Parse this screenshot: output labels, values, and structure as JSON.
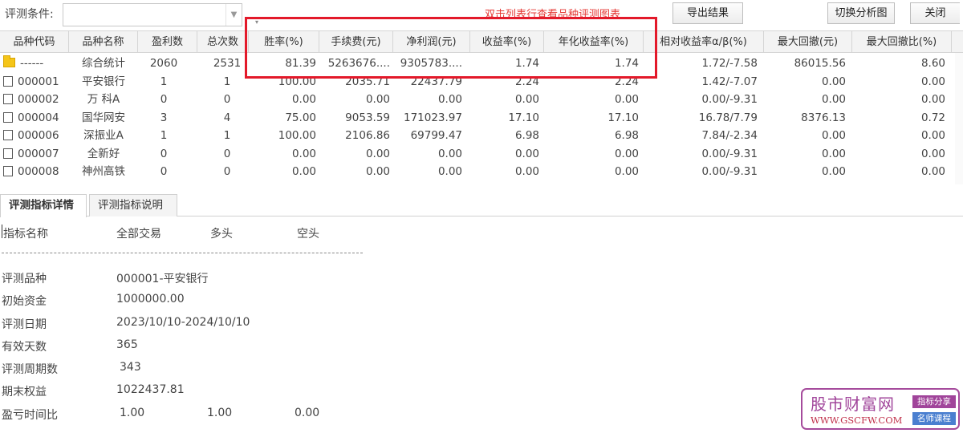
{
  "toolbar": {
    "condition_label": "评测条件:",
    "condition_value": "",
    "hint": "双击列表行查看品种评测图表",
    "export_label": "导出结果",
    "switch_label": "切换分析图",
    "close_label": "关闭"
  },
  "grid": {
    "headers": [
      "品种代码",
      "品种名称",
      "盈利数",
      "总次数",
      "胜率(%)",
      "手续费(元)",
      "净利润(元)",
      "收益率(%)",
      "年化收益率(%)",
      "相对收益率α/β(%)",
      "最大回撤(元)",
      "最大回撤比(%)"
    ],
    "rows": [
      {
        "code": "------",
        "name": "综合统计",
        "wins": "2060",
        "total": "2531",
        "win_rate": "81.39",
        "fee": "5263676....",
        "net": "9305783....",
        "ret": "1.74",
        "annual": "1.74",
        "rel": "1.72/-7.58",
        "dd": "86015.56",
        "dd_ratio": "8.60"
      },
      {
        "code": "000001",
        "name": "平安银行",
        "wins": "1",
        "total": "1",
        "win_rate": "100.00",
        "fee": "2035.71",
        "net": "22437.79",
        "ret": "2.24",
        "annual": "2.24",
        "rel": "1.42/-7.07",
        "dd": "0.00",
        "dd_ratio": "0.00"
      },
      {
        "code": "000002",
        "name": "万 科A",
        "wins": "0",
        "total": "0",
        "win_rate": "0.00",
        "fee": "0.00",
        "net": "0.00",
        "ret": "0.00",
        "annual": "0.00",
        "rel": "0.00/-9.31",
        "dd": "0.00",
        "dd_ratio": "0.00"
      },
      {
        "code": "000004",
        "name": "国华网安",
        "wins": "3",
        "total": "4",
        "win_rate": "75.00",
        "fee": "9053.59",
        "net": "171023.97",
        "ret": "17.10",
        "annual": "17.10",
        "rel": "16.78/7.79",
        "dd": "8376.13",
        "dd_ratio": "0.72"
      },
      {
        "code": "000006",
        "name": "深振业A",
        "wins": "1",
        "total": "1",
        "win_rate": "100.00",
        "fee": "2106.86",
        "net": "69799.47",
        "ret": "6.98",
        "annual": "6.98",
        "rel": "7.84/-2.34",
        "dd": "0.00",
        "dd_ratio": "0.00"
      },
      {
        "code": "000007",
        "name": "全新好",
        "wins": "0",
        "total": "0",
        "win_rate": "0.00",
        "fee": "0.00",
        "net": "0.00",
        "ret": "0.00",
        "annual": "0.00",
        "rel": "0.00/-9.31",
        "dd": "0.00",
        "dd_ratio": "0.00"
      },
      {
        "code": "000008",
        "name": "神州高铁",
        "wins": "0",
        "total": "0",
        "win_rate": "0.00",
        "fee": "0.00",
        "net": "0.00",
        "ret": "0.00",
        "annual": "0.00",
        "rel": "0.00/-9.31",
        "dd": "0.00",
        "dd_ratio": "0.00"
      }
    ]
  },
  "tabs": {
    "detail": "评测指标详情",
    "explain": "评测指标说明"
  },
  "detail": {
    "headers": {
      "metric": "指标名称",
      "all": "全部交易",
      "long": "多头",
      "short": "空头"
    },
    "items": [
      {
        "label": "评测品种",
        "value": "000001-平安银行"
      },
      {
        "label": "初始资金",
        "value": "1000000.00"
      },
      {
        "label": "评测日期",
        "value": "2023/10/10-2024/10/10"
      },
      {
        "label": "有效天数",
        "value": "365"
      },
      {
        "label": "评测周期数",
        "value": "343"
      },
      {
        "label": "期末权益",
        "value": "1022437.81"
      }
    ],
    "ratio_row": {
      "label": "盈亏时间比",
      "all": "1.00",
      "long": "1.00",
      "short": "0.00"
    }
  },
  "watermark": {
    "title": "股市财富网",
    "url": "WWW.GSCFW.COM",
    "tag1": "指标分享",
    "tag2": "名师课程"
  },
  "colors": {
    "highlight_box": "#e3192a",
    "hint_text": "#e53935",
    "watermark": "#a0449a"
  }
}
